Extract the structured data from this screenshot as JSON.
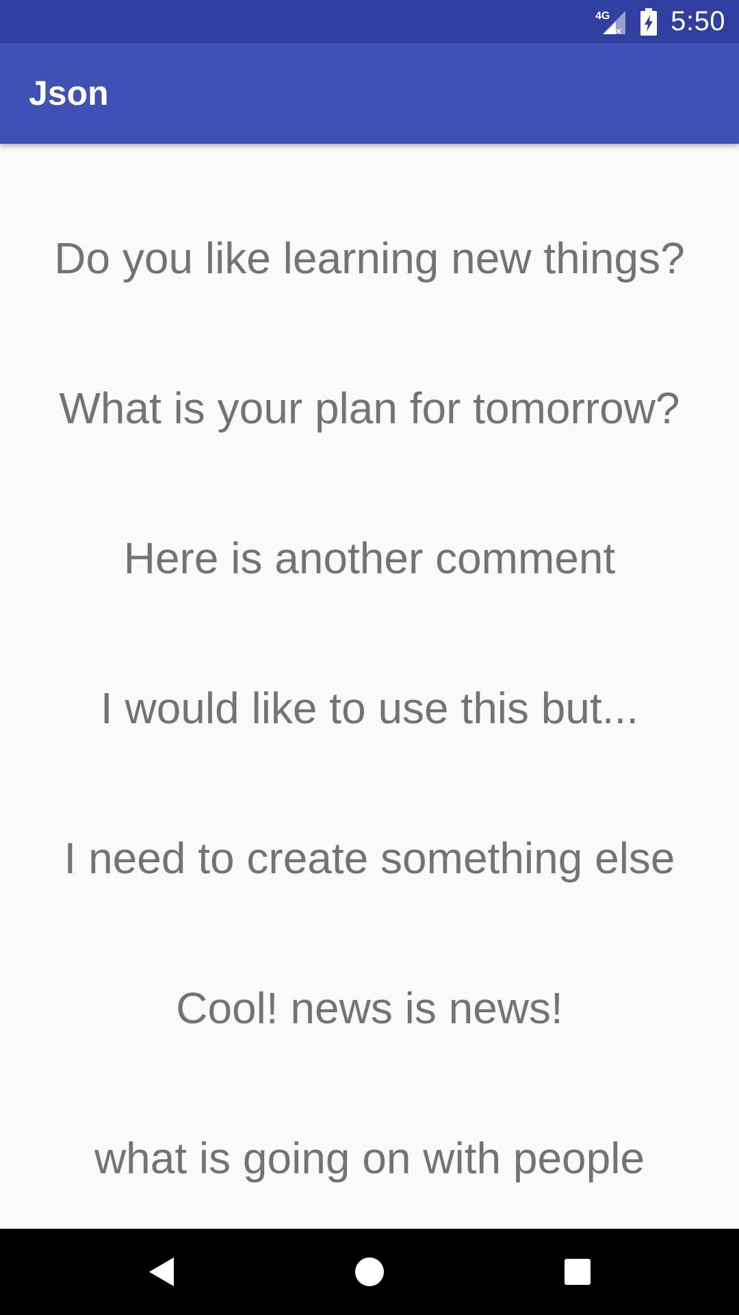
{
  "status_bar": {
    "network_label": "4G",
    "time": "5:50"
  },
  "app_bar": {
    "title": "Json"
  },
  "list": {
    "items": [
      "Do you like learning new things?",
      "What is your plan for tomorrow?",
      "Here is another comment",
      "I would like to use this but...",
      "I need to create something else",
      "Cool! news is news!",
      "what is going on with people"
    ]
  },
  "nav_bar": {
    "icons": [
      "back-icon",
      "home-icon",
      "recents-icon"
    ]
  },
  "colors": {
    "status_bar": "#303f9f",
    "app_bar": "#3f51b5",
    "background": "#fafafa",
    "item_text": "#737373",
    "nav_bar": "#000000"
  }
}
